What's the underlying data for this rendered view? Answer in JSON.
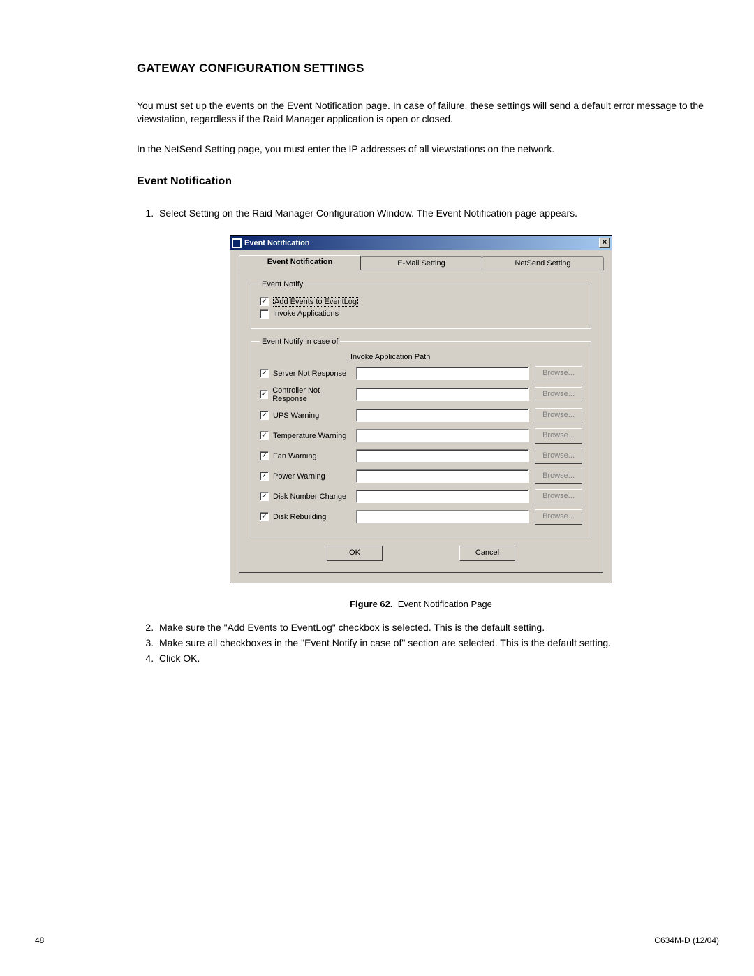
{
  "section_title": "GATEWAY CONFIGURATION SETTINGS",
  "intro_para": "You must set up the events on the Event Notification page. In case of failure, these settings will send a default error message to the viewstation, regardless if the Raid Manager application is open or closed.",
  "netsend_para": "In the NetSend Setting page, you must enter the IP addresses of all viewstations on the network.",
  "sub_title": "Event Notification",
  "step1": "Select Setting on the Raid Manager Configuration Window. The Event Notification page appears.",
  "dialog": {
    "window_title": "Event Notification",
    "close_label": "×",
    "tabs": {
      "event_notification": "Event Notification",
      "email_setting": "E-Mail Setting",
      "netsend_setting": "NetSend Setting"
    },
    "groups": {
      "event_notify_legend": "Event Notify",
      "add_events_label": "Add Events to EventLog",
      "invoke_apps_label": "Invoke Applications",
      "case_of_legend": "Event Notify in case of",
      "path_header": "Invoke Application Path"
    },
    "events": [
      {
        "label": "Server Not Response",
        "browse": "Browse..."
      },
      {
        "label": "Controller Not Response",
        "browse": "Browse..."
      },
      {
        "label": "UPS Warning",
        "browse": "Browse..."
      },
      {
        "label": "Temperature Warning",
        "browse": "Browse..."
      },
      {
        "label": "Fan Warning",
        "browse": "Browse..."
      },
      {
        "label": "Power Warning",
        "browse": "Browse..."
      },
      {
        "label": "Disk Number Change",
        "browse": "Browse..."
      },
      {
        "label": "Disk Rebuilding",
        "browse": "Browse..."
      }
    ],
    "ok": "OK",
    "cancel": "Cancel"
  },
  "figure_label": "Figure 62.",
  "figure_text": "Event Notification Page",
  "step2": "Make sure the \"Add Events to EventLog\" checkbox is selected. This is the default setting.",
  "step3": "Make sure all checkboxes in the \"Event Notify in case of\" section are selected. This is the default setting.",
  "step4": "Click OK.",
  "page_number": "48",
  "doc_id": "C634M-D (12/04)"
}
